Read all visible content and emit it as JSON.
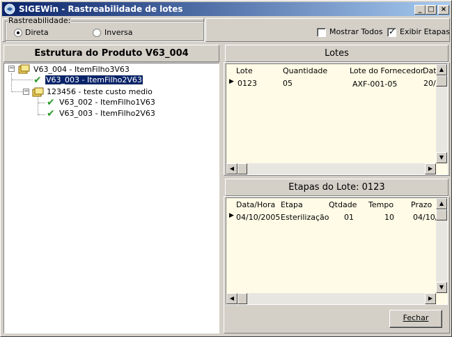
{
  "window": {
    "title": "SIGEWin - Rastreabilidade de lotes",
    "controls": [
      "_",
      "□",
      "×"
    ]
  },
  "options": {
    "group_label": "Rastreabilidade:",
    "direta": {
      "label": "Direta",
      "checked": true
    },
    "inversa": {
      "label": "Inversa",
      "checked": false
    },
    "mostrar_todos": {
      "label": "Mostrar Todos",
      "checked": false
    },
    "exibir_etapas": {
      "label": "Exibir Etapas",
      "checked": true
    }
  },
  "estrutura": {
    "title": "Estrutura do Produto V63_004",
    "nodes": [
      {
        "label": "V63_004 - ItemFilho3V63",
        "icon": "lot-folder-icon",
        "expander": "⊟"
      },
      {
        "label": "V63_003 - ItemFilho2V63",
        "icon": "check-icon",
        "selected": true
      },
      {
        "label": "123456 - teste custo medio",
        "icon": "lot-folder-icon",
        "expander": "⊟"
      },
      {
        "label": "V63_002 - ItemFilho1V63",
        "icon": "check-icon"
      },
      {
        "label": "V63_003 - ItemFilho2V63",
        "icon": "check-icon"
      }
    ]
  },
  "lotes": {
    "title": "Lotes",
    "columns": [
      "Lote",
      "Quantidade",
      "Lote do Fornecedor",
      "Dat"
    ],
    "rows": [
      [
        "0123",
        "05",
        "AXF-001-05",
        "20/"
      ]
    ]
  },
  "etapas": {
    "title": "Etapas do Lote: 0123",
    "columns": [
      "Data/Hora",
      "Etapa",
      "Qtdade",
      "Tempo",
      "Prazo"
    ],
    "rows": [
      [
        "04/10/2005",
        "Esterilização",
        "01",
        "10",
        "04/10/"
      ]
    ]
  },
  "buttons": {
    "fechar": "Fechar"
  },
  "colors": {
    "title_start": "#0a246a",
    "title_end": "#a6caf0",
    "grid_bg": "#fffbe6",
    "selection": "#0a246a",
    "check": "#2a9a2a"
  }
}
